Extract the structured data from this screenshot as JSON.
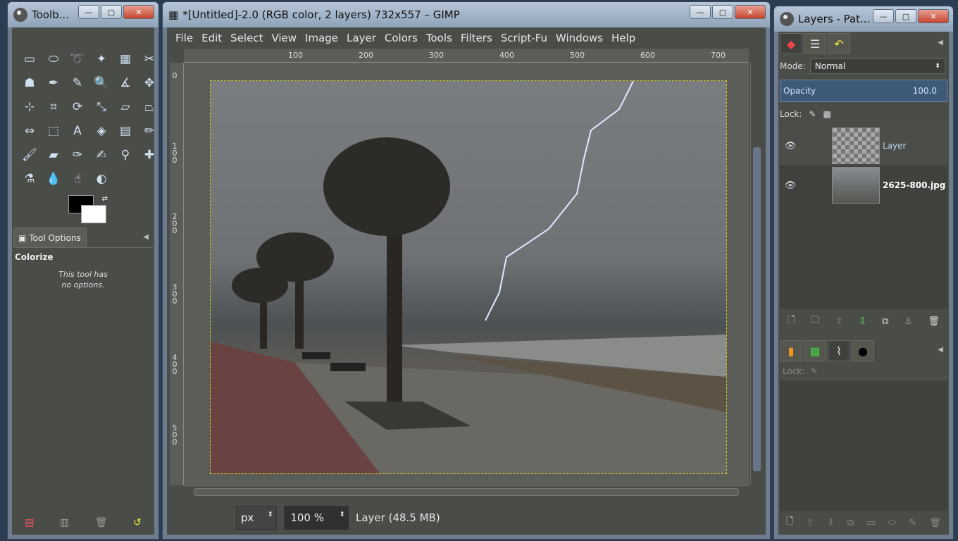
{
  "toolbox": {
    "title": "Toolb...",
    "tools": [
      {
        "name": "rect-select-icon",
        "glyph": "▭"
      },
      {
        "name": "ellipse-select-icon",
        "glyph": "⬭"
      },
      {
        "name": "free-select-icon",
        "glyph": "➰"
      },
      {
        "name": "fuzzy-select-icon",
        "glyph": "✦"
      },
      {
        "name": "select-by-color-icon",
        "glyph": "▦"
      },
      {
        "name": "scissors-select-icon",
        "glyph": "✂"
      },
      {
        "name": "foreground-select-icon",
        "glyph": "☗"
      },
      {
        "name": "paths-icon",
        "glyph": "✒"
      },
      {
        "name": "color-picker-icon",
        "glyph": "✎"
      },
      {
        "name": "zoom-icon",
        "glyph": "🔍"
      },
      {
        "name": "measure-icon",
        "glyph": "∡"
      },
      {
        "name": "move-icon",
        "glyph": "✥"
      },
      {
        "name": "align-icon",
        "glyph": "⊹"
      },
      {
        "name": "crop-icon",
        "glyph": "⌗"
      },
      {
        "name": "rotate-icon",
        "glyph": "⟳"
      },
      {
        "name": "scale-icon",
        "glyph": "⤡"
      },
      {
        "name": "shear-icon",
        "glyph": "▱"
      },
      {
        "name": "perspective-icon",
        "glyph": "⏢"
      },
      {
        "name": "flip-icon",
        "glyph": "⇔"
      },
      {
        "name": "cage-transform-icon",
        "glyph": "⬚"
      },
      {
        "name": "text-icon",
        "glyph": "A"
      },
      {
        "name": "bucket-fill-icon",
        "glyph": "◈"
      },
      {
        "name": "blend-icon",
        "glyph": "▤"
      },
      {
        "name": "pencil-icon",
        "glyph": "✏"
      },
      {
        "name": "paintbrush-icon",
        "glyph": "🖌"
      },
      {
        "name": "eraser-icon",
        "glyph": "▰"
      },
      {
        "name": "airbrush-icon",
        "glyph": "✑"
      },
      {
        "name": "ink-icon",
        "glyph": "✍"
      },
      {
        "name": "clone-icon",
        "glyph": "⚲"
      },
      {
        "name": "heal-icon",
        "glyph": "✚"
      },
      {
        "name": "perspective-clone-icon",
        "glyph": "⚗"
      },
      {
        "name": "blur-sharpen-icon",
        "glyph": "💧"
      },
      {
        "name": "smudge-icon",
        "glyph": "☝"
      },
      {
        "name": "dodge-burn-icon",
        "glyph": "◐"
      }
    ],
    "tab_label": "Tool Options",
    "active_tool": "Colorize",
    "note_line1": "This tool has",
    "note_line2": "no options.",
    "bottom_icons": [
      "save-options-icon",
      "restore-options-icon",
      "delete-options-icon",
      "reset-options-icon"
    ]
  },
  "image_window": {
    "title": "*[Untitled]-2.0 (RGB color, 2 layers) 732x557 – GIMP",
    "menu": [
      "File",
      "Edit",
      "Select",
      "View",
      "Image",
      "Layer",
      "Colors",
      "Tools",
      "Filters",
      "Script-Fu",
      "Windows",
      "Help"
    ],
    "ruler_h": [
      "100",
      "200",
      "300",
      "400",
      "500",
      "600",
      "700"
    ],
    "ruler_v": [
      "100",
      "200",
      "300",
      "400",
      "500"
    ],
    "ruler_v_zero": "0",
    "unit": "px",
    "zoom": "100 %",
    "status": "Layer (48.5 MB)"
  },
  "layers_window": {
    "title": "Layers - Pat...",
    "mode_label": "Mode:",
    "mode_value": "Normal",
    "opacity_label": "Opacity",
    "opacity_value": "100.0",
    "lock_label": "Lock:",
    "layers": [
      {
        "name": "Layer",
        "selected": true
      },
      {
        "name": "2625-800.jpg",
        "selected": false
      }
    ],
    "dock2_lock_label": "Lock:"
  }
}
